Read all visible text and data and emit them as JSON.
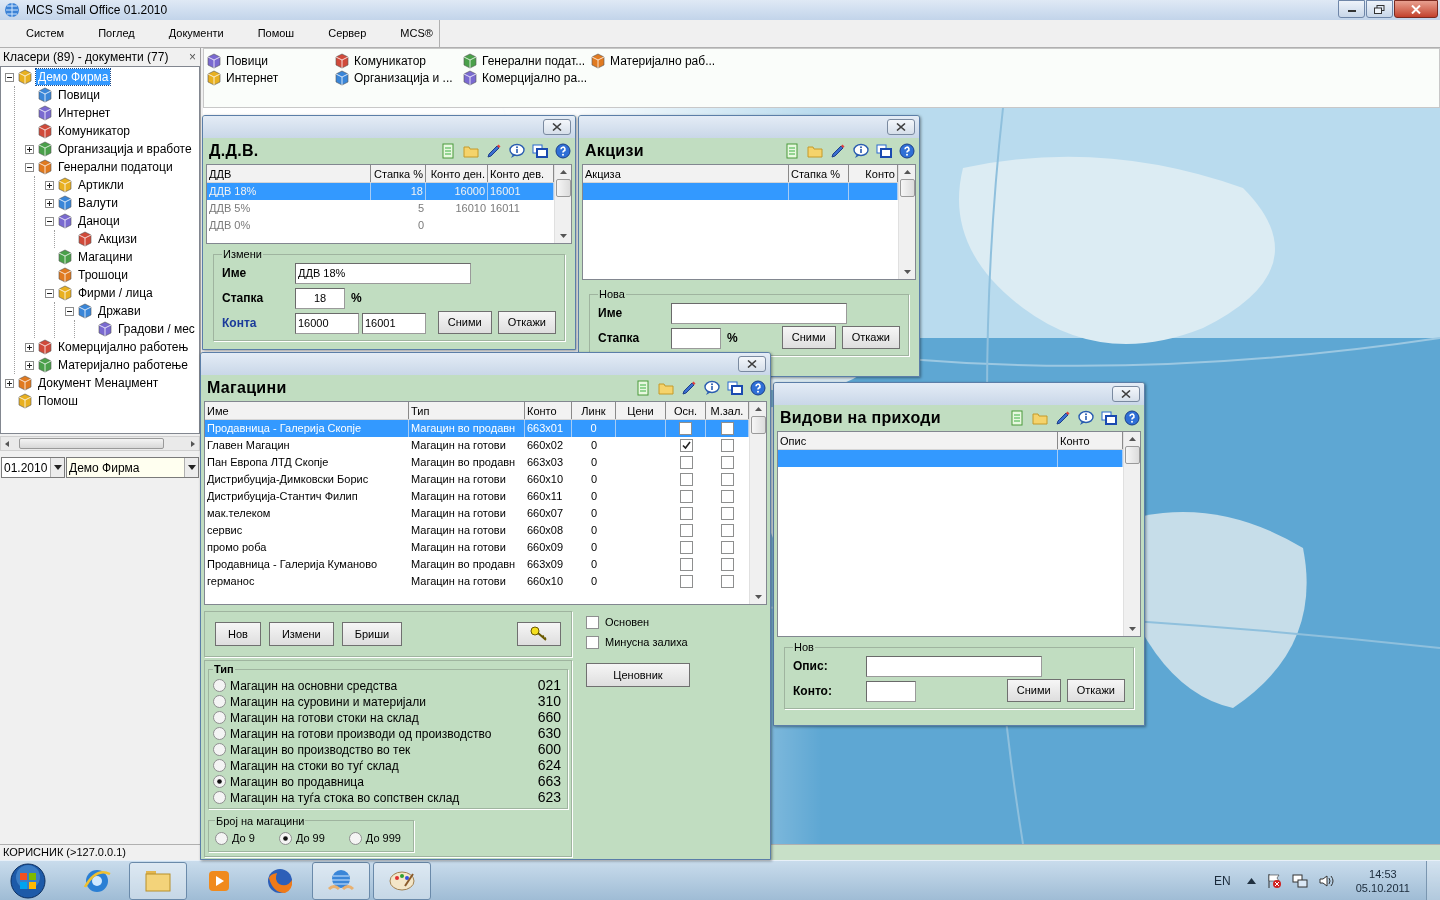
{
  "window": {
    "title": "MCS Small Office 01.2010"
  },
  "menu": [
    {
      "label": "Систем"
    },
    {
      "label": "Поглед"
    },
    {
      "label": "Документи"
    },
    {
      "label": "Помош"
    },
    {
      "label": "Сервер"
    },
    {
      "label": "MCS®"
    }
  ],
  "sidebar": {
    "title": "Класери (89) - документи (77)",
    "close": "×",
    "period": "01.2010",
    "company": "Демо Фирма",
    "tree": [
      {
        "label": "Демо Фирма",
        "selected": true,
        "expanded": true,
        "children": [
          {
            "label": "Повици",
            "selected": false
          },
          {
            "label": "Интернет",
            "selected": false
          },
          {
            "label": "Комуникатор",
            "selected": false
          },
          {
            "label": "Организација и вработе",
            "selected": false,
            "expanded": false
          },
          {
            "label": "Генерални податоци",
            "selected": false,
            "expanded": true,
            "children": [
              {
                "label": "Артикли",
                "selected": false,
                "expanded": false
              },
              {
                "label": "Валути",
                "selected": false,
                "expanded": false
              },
              {
                "label": "Даноци",
                "selected": false,
                "expanded": true,
                "children": [
                  {
                    "label": "Акцизи",
                    "selected": false
                  }
                ]
              },
              {
                "label": "Магацини",
                "selected": false
              },
              {
                "label": "Трошоци",
                "selected": false
              },
              {
                "label": "Фирми / лица",
                "selected": false,
                "expanded": true,
                "children": [
                  {
                    "label": "Држави",
                    "selected": false,
                    "expanded": true,
                    "children": [
                      {
                        "label": "Градови / мес",
                        "selected": false
                      }
                    ]
                  }
                ]
              }
            ]
          },
          {
            "label": "Комерцијално работењ",
            "selected": false,
            "expanded": false
          },
          {
            "label": "Материјално работење",
            "selected": false,
            "expanded": false
          }
        ]
      },
      {
        "label": "Документ Менаџмент",
        "selected": false,
        "expanded": false
      },
      {
        "label": "Помош",
        "selected": false
      }
    ]
  },
  "shortcuts": [
    "Повици",
    "Комуникатор",
    "Генерални подат...",
    "Материјално раб...",
    "Интернет",
    "Организација и ...",
    "Комерцијално ра..."
  ],
  "ddv": {
    "title": "Д.Д.В.",
    "table": {
      "disabled": true,
      "columns": [
        "ДДВ",
        "Стапка %",
        "Конто ден.",
        "Конто дев."
      ],
      "rows": [
        {
          "selected": true,
          "cells": [
            "ДДВ 18%",
            "18",
            "16000",
            "16001"
          ]
        },
        {
          "selected": false,
          "cells": [
            "ДДВ 5%",
            "5",
            "16010",
            "16011"
          ]
        },
        {
          "selected": false,
          "cells": [
            "ДДВ 0%",
            "0"
          ]
        }
      ]
    },
    "form": {
      "legend": "Измени",
      "fields": [
        {
          "label": "Име",
          "link": false,
          "values": [
            "ДДВ 18%"
          ]
        },
        {
          "label": "Стапка",
          "link": false,
          "values": [
            "18"
          ],
          "suffix": "%"
        },
        {
          "label": "Конта",
          "link": true,
          "values": [
            "16000",
            "16001"
          ]
        }
      ],
      "buttons": [
        "Сними",
        "Откажи"
      ]
    }
  },
  "excise": {
    "title": "Акцизи",
    "table": {
      "columns": [
        "Акциза",
        "Стапка %",
        "Конто"
      ],
      "rows": [
        {
          "selected": true
        }
      ]
    },
    "form": {
      "legend": "Нова",
      "fields": [
        {
          "label": "Име",
          "link": false
        },
        {
          "label": "Стапка",
          "link": false,
          "suffix": "%"
        }
      ],
      "buttons": [
        "Сними",
        "Откажи"
      ]
    }
  },
  "warehouses": {
    "title": "Магацини",
    "table": {
      "columns": [
        "Име",
        "Тип",
        "Конто",
        "Линк",
        "Цени",
        "Осн.",
        "М.зал."
      ],
      "rows": [
        {
          "selected": true,
          "name": "Продавница - Галерија Скопје",
          "type": "Магацин во продавн",
          "konto": "663x01",
          "link": "0",
          "osn": false,
          "mzal": false
        },
        {
          "selected": false,
          "name": "Главен Магацин",
          "type": "Магацин на готови",
          "konto": "660x02",
          "link": "0",
          "osn": true,
          "mzal": false
        },
        {
          "selected": false,
          "name": "Пан Европа ЛТД  Скопје",
          "type": "Магацин во продавн",
          "konto": "663x03",
          "link": "0",
          "osn": false,
          "mzal": false
        },
        {
          "selected": false,
          "name": "Дистрибуција-Димковски Борис",
          "type": "Магацин на готови",
          "konto": "660x10",
          "link": "0",
          "osn": false,
          "mzal": false
        },
        {
          "selected": false,
          "name": "Дистрибуција-Стантич Филип",
          "type": "Магацин на готови",
          "konto": "660x11",
          "link": "0",
          "osn": false,
          "mzal": false
        },
        {
          "selected": false,
          "name": "мак.телеком",
          "type": "Магацин на готови",
          "konto": "660x07",
          "link": "0",
          "osn": false,
          "mzal": false
        },
        {
          "selected": false,
          "name": "сервис",
          "type": "Магацин на готови",
          "konto": "660x08",
          "link": "0",
          "osn": false,
          "mzal": false
        },
        {
          "selected": false,
          "name": "промо роба",
          "type": "Магацин на готови",
          "konto": "660x09",
          "link": "0",
          "osn": false,
          "mzal": false
        },
        {
          "selected": false,
          "name": "Продавница - Галерија Куманово",
          "type": "Магацин во продавн",
          "konto": "663x09",
          "link": "0",
          "osn": false,
          "mzal": false
        },
        {
          "selected": false,
          "name": "германос",
          "type": "Магацин на готови",
          "konto": "660x10",
          "link": "0",
          "osn": false,
          "mzal": false
        }
      ]
    },
    "buttons": [
      "Нов",
      "Измени",
      "Бриши"
    ],
    "options": [
      {
        "label": "Основен",
        "checked": false
      },
      {
        "label": "Минусна залиха",
        "checked": false
      }
    ],
    "price_list_button": "Ценовник",
    "type_group": {
      "legend": "Тип",
      "options": [
        {
          "label": "Магацин на основни средства",
          "code": "021",
          "selected": false
        },
        {
          "label": "Магацин на суровини и материјали",
          "code": "310",
          "selected": false
        },
        {
          "label": "Магацин на готови стоки на склад",
          "code": "660",
          "selected": false
        },
        {
          "label": "Магацин на готови производи од производство",
          "code": "630",
          "selected": false
        },
        {
          "label": "Магацин во производство во тек",
          "code": "600",
          "selected": false
        },
        {
          "label": "Магацин на стоки во туѓ склад",
          "code": "624",
          "selected": false
        },
        {
          "label": "Магацин во продавница",
          "code": "663",
          "selected": true
        },
        {
          "label": "Магацин на туѓа стока во сопствен склад",
          "code": "623",
          "selected": false
        }
      ]
    },
    "count_group": {
      "legend": "Број на магацини",
      "options": [
        {
          "label": "До 9",
          "selected": false
        },
        {
          "label": "До 99",
          "selected": true
        },
        {
          "label": "До 999",
          "selected": false
        }
      ]
    }
  },
  "income_types": {
    "title": "Видови на приходи",
    "table": {
      "columns": [
        "Опис",
        "Конто"
      ],
      "rows": [
        {
          "selected": true
        }
      ]
    },
    "form": {
      "legend": "Нов",
      "fields": [
        {
          "label": "Опис:",
          "link": false
        },
        {
          "label": "Конто:",
          "link": false
        }
      ],
      "buttons": [
        "Сними",
        "Откажи"
      ]
    }
  },
  "status_bar": {
    "user": "КОРИСНИК (>127.0.0.1)"
  },
  "taskbar": {
    "apps": [
      {
        "kind": "browser",
        "running": false
      },
      {
        "kind": "folder",
        "running": true
      },
      {
        "kind": "player",
        "running": false
      },
      {
        "kind": "fox",
        "running": false
      },
      {
        "kind": "mcs",
        "running": true
      },
      {
        "kind": "paint",
        "running": true
      }
    ],
    "language": "EN",
    "time": "14:53",
    "date": "05.10.2011"
  }
}
